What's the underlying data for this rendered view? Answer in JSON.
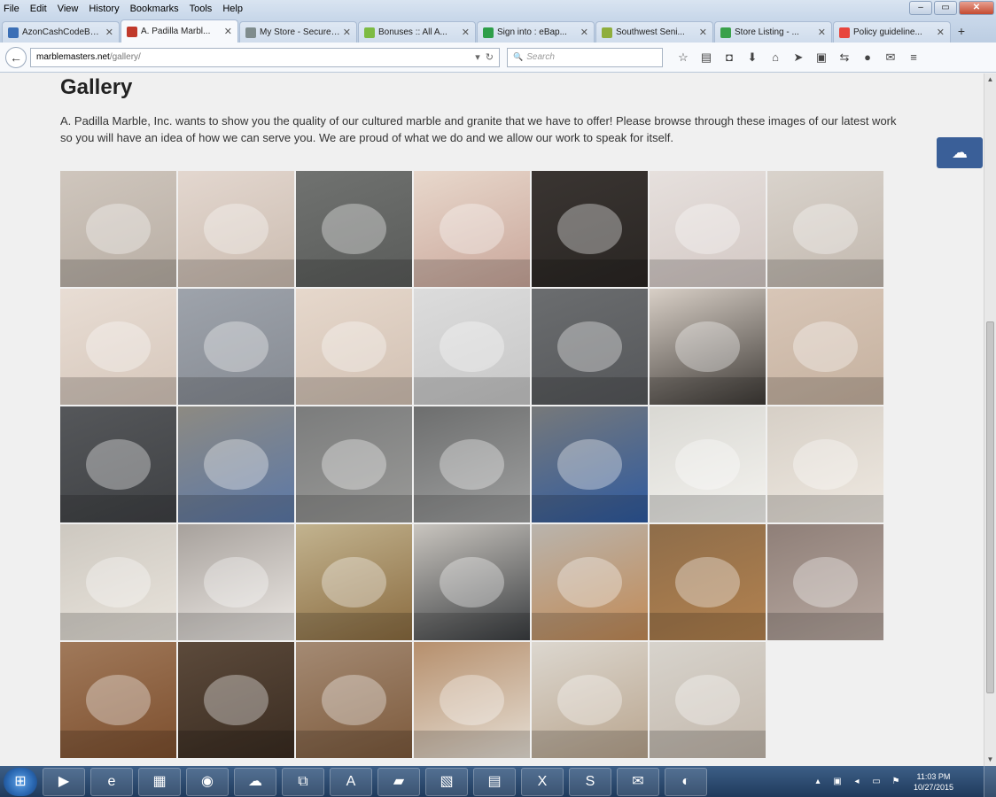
{
  "menubar": {
    "items": [
      "File",
      "Edit",
      "View",
      "History",
      "Bookmarks",
      "Tools",
      "Help"
    ]
  },
  "window": {
    "minimize": "–",
    "maximize": "▭",
    "close": "✕"
  },
  "tabs": [
    {
      "label": "AzonCashCodeBon...",
      "active": false,
      "color": "#3b6fb6"
    },
    {
      "label": "A. Padilla Marbl...",
      "active": true,
      "color": "#c0392b"
    },
    {
      "label": "My Store - Secure O...",
      "active": false,
      "color": "#7f8c8d"
    },
    {
      "label": "Bonuses :: All A...",
      "active": false,
      "color": "#7dbb43"
    },
    {
      "label": "Sign into : eBap...",
      "active": false,
      "color": "#2e9e49"
    },
    {
      "label": "Southwest Seni...",
      "active": false,
      "color": "#8fae3c"
    },
    {
      "label": "Store Listing - ...",
      "active": false,
      "color": "#3aa14a"
    },
    {
      "label": "Policy guideline...",
      "active": false,
      "color": "#e8453c"
    }
  ],
  "new_tab_label": "+",
  "navbar": {
    "back": "←",
    "url_host": "marblemasters.net",
    "url_path": "/gallery/",
    "url_dropdown": "▾",
    "url_reload": "↻",
    "search_placeholder": "Search",
    "search_icon": "🔍",
    "toolbar_icons": [
      {
        "name": "bookmark-star-icon",
        "glyph": "☆"
      },
      {
        "name": "clipboard-icon",
        "glyph": "▤"
      },
      {
        "name": "pocket-icon",
        "glyph": "◘"
      },
      {
        "name": "download-icon",
        "glyph": "⬇"
      },
      {
        "name": "home-icon",
        "glyph": "⌂"
      },
      {
        "name": "send-icon",
        "glyph": "➤"
      },
      {
        "name": "screenshot-icon",
        "glyph": "▣"
      },
      {
        "name": "addon-icon",
        "glyph": "⇆"
      },
      {
        "name": "addon-orange-icon",
        "glyph": "●"
      },
      {
        "name": "chat-icon",
        "glyph": "✉"
      },
      {
        "name": "menu-icon",
        "glyph": "≡"
      }
    ]
  },
  "page": {
    "title": "Gallery",
    "intro": "A. Padilla Marble, Inc. wants to show you the quality of our cultured marble and granite that we have to offer! Please browse through these images of our latest work so you will have an idea of how we can serve you. We are proud of what we do and we allow our work to speak for itself.",
    "side_widget": "☁"
  },
  "gallery": [
    {
      "name": "scalloped-marble-sink",
      "bg": "#cfc6bd",
      "accent": "#b8aea4"
    },
    {
      "name": "shell-sink-gold-faucet",
      "bg": "#e3d7cf",
      "accent": "#cbbcb0"
    },
    {
      "name": "gray-granite-sink",
      "bg": "#707270",
      "accent": "#5a5c5a"
    },
    {
      "name": "oval-sink-flowers",
      "bg": "#e8d8cc",
      "accent": "#c9a69a"
    },
    {
      "name": "dark-marble-steps",
      "bg": "#3a3532",
      "accent": "#2a2623"
    },
    {
      "name": "shower-niche-bottles",
      "bg": "#e6e0dd",
      "accent": "#d3c8c4"
    },
    {
      "name": "shower-shelf-niche",
      "bg": "#d9d3cc",
      "accent": "#c2b8ae"
    },
    {
      "name": "marble-wall-niche",
      "bg": "#e8ddd4",
      "accent": "#d6c7bb"
    },
    {
      "name": "gray-marble-shower",
      "bg": "#9ea3ab",
      "accent": "#868b93"
    },
    {
      "name": "shower-corner-seat",
      "bg": "#e6d8cc",
      "accent": "#d2c1b3"
    },
    {
      "name": "white-shower-niche",
      "bg": "#dcdcdc",
      "accent": "#c7c7c7"
    },
    {
      "name": "granite-shower-glass",
      "bg": "#6b6d6f",
      "accent": "#55575a"
    },
    {
      "name": "glass-shower-doors",
      "bg": "#d8cfc6",
      "accent": "#3e3a36"
    },
    {
      "name": "marble-corner-bench",
      "bg": "#d8c6b7",
      "accent": "#c5b19f"
    },
    {
      "name": "dark-granite-bench",
      "bg": "#55575a",
      "accent": "#3f4144"
    },
    {
      "name": "workshop-molds-blue",
      "bg": "#8d8a82",
      "accent": "#5b78a8"
    },
    {
      "name": "workshop-long-tables",
      "bg": "#7b7c7c",
      "accent": "#9a9a98"
    },
    {
      "name": "workshop-steel-molds",
      "bg": "#6d6e6e",
      "accent": "#a0a1a1"
    },
    {
      "name": "workshop-mold-rows",
      "bg": "#77797a",
      "accent": "#2e5aa0"
    },
    {
      "name": "pedestal-sink-white",
      "bg": "#d9d8d3",
      "accent": "#f4f3ef"
    },
    {
      "name": "pedestal-sink-towel",
      "bg": "#d6cfc6",
      "accent": "#efe9e1"
    },
    {
      "name": "pedestal-sink-ring",
      "bg": "#cdc8c0",
      "accent": "#e9e4dc"
    },
    {
      "name": "scalloped-white-sink",
      "bg": "#a7a19c",
      "accent": "#eeeae6"
    },
    {
      "name": "office-doorways",
      "bg": "#c2b38f",
      "accent": "#8a6b3f"
    },
    {
      "name": "office-chairs-desk",
      "bg": "#c9c5bf",
      "accent": "#3a3d40"
    },
    {
      "name": "wood-cabinet-column",
      "bg": "#b9b4ad",
      "accent": "#c28a55"
    },
    {
      "name": "kitchen-wood-cabinets",
      "bg": "#8e6d4a",
      "accent": "#b3824f"
    },
    {
      "name": "stainless-double-sink",
      "bg": "#8f7f78",
      "accent": "#b8a9a1"
    },
    {
      "name": "vanity-wine-glasses",
      "bg": "#a0795a",
      "accent": "#7d4f2e"
    },
    {
      "name": "dark-vanity-bottle",
      "bg": "#5c4a3b",
      "accent": "#3a2c21"
    },
    {
      "name": "vanity-tray-glasses",
      "bg": "#a48a73",
      "accent": "#7d5a3c"
    },
    {
      "name": "reception-desk-curved",
      "bg": "#b68f6c",
      "accent": "#e6dfd5"
    },
    {
      "name": "marble-sample-panels",
      "bg": "#dcd7cf",
      "accent": "#b9a58e"
    },
    {
      "name": "marble-color-samples",
      "bg": "#d7d3cc",
      "accent": "#c3b8ac"
    }
  ],
  "taskbar": {
    "start": "⊞",
    "apps": [
      {
        "name": "media-player-icon",
        "glyph": "▶"
      },
      {
        "name": "internet-explorer-icon",
        "glyph": "e"
      },
      {
        "name": "file-explorer-icon",
        "glyph": "▦"
      },
      {
        "name": "chrome-icon",
        "glyph": "◉"
      },
      {
        "name": "cloud-app-icon",
        "glyph": "☁"
      },
      {
        "name": "network-app-icon",
        "glyph": "⧉"
      },
      {
        "name": "acrobat-icon",
        "glyph": "A"
      },
      {
        "name": "file-app-icon",
        "glyph": "▰"
      },
      {
        "name": "presentation-icon",
        "glyph": "▧"
      },
      {
        "name": "document-app-icon",
        "glyph": "▤"
      },
      {
        "name": "excel-icon",
        "glyph": "X"
      },
      {
        "name": "skype-icon",
        "glyph": "S"
      },
      {
        "name": "thunderbird-icon",
        "glyph": "✉"
      },
      {
        "name": "firefox-icon",
        "glyph": "◐"
      }
    ],
    "tray_icons": [
      "▴",
      "▣",
      "◂",
      "▭",
      "⚑"
    ],
    "time": "11:03 PM",
    "date": "10/27/2015"
  }
}
